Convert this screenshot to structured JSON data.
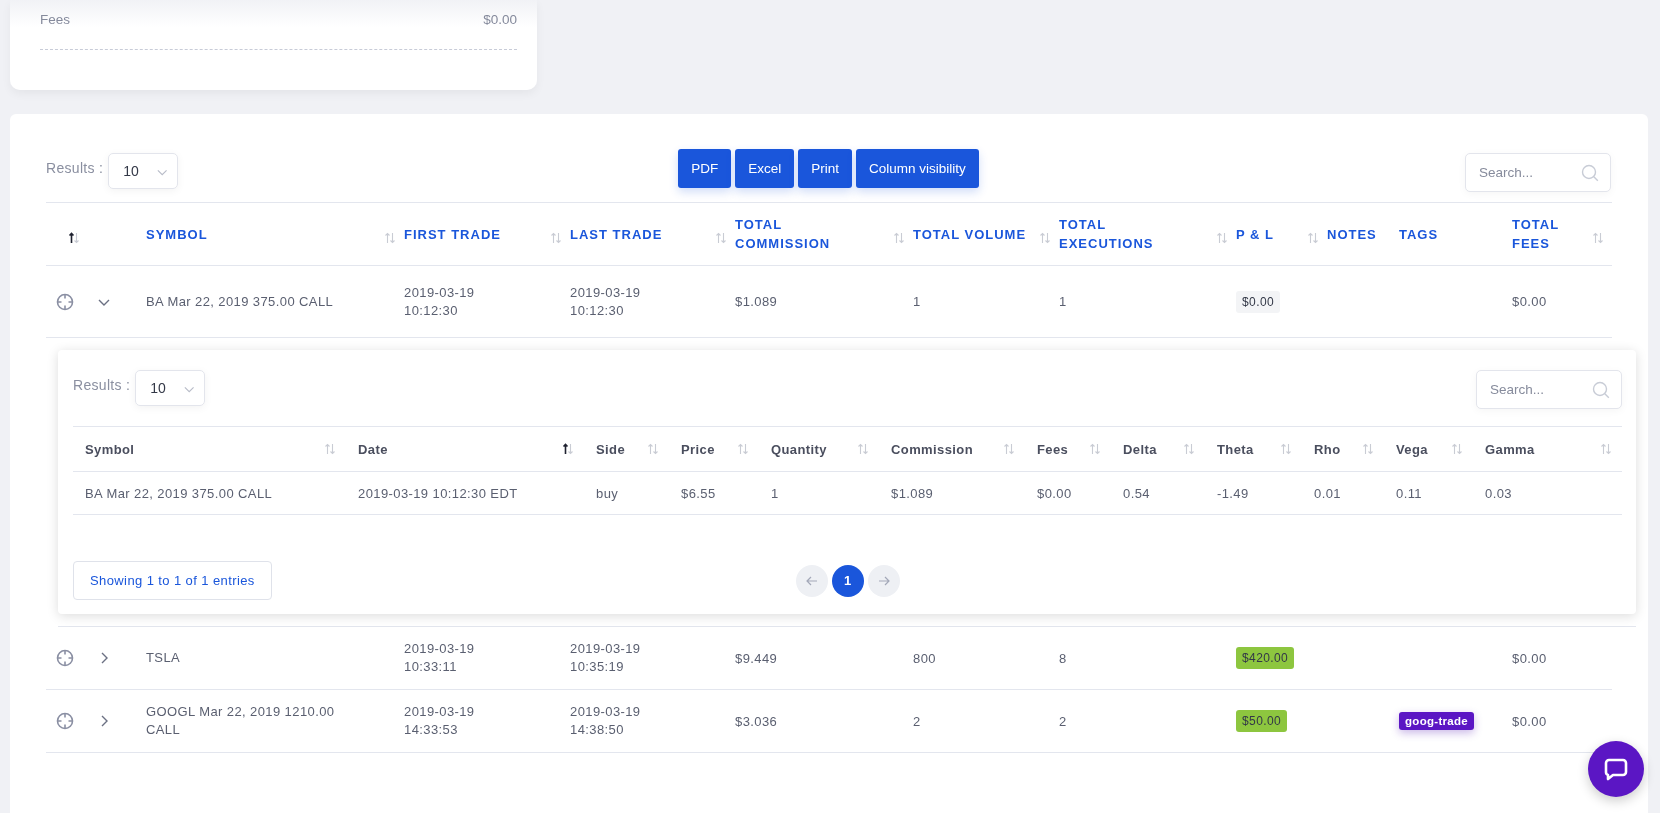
{
  "summary": {
    "rows": [
      {
        "label": "Fees",
        "value": "$0.00"
      }
    ]
  },
  "trades": {
    "results": {
      "label": "Results :",
      "value": "10"
    },
    "buttons": [
      "PDF",
      "Excel",
      "Print",
      "Column visibility"
    ],
    "search": {
      "placeholder": "Search..."
    },
    "columns": [
      {
        "sortable": true,
        "sorted": true
      },
      {
        "label": "SYMBOL",
        "sortable": true,
        "sorted": false
      },
      {
        "label": "FIRST TRADE",
        "sortable": true,
        "sorted": false
      },
      {
        "label": "LAST TRADE",
        "sortable": true,
        "sorted": false
      },
      {
        "label": "TOTAL COMMISSION",
        "sortable": true,
        "sorted": false
      },
      {
        "label": "TOTAL VOLUME",
        "sortable": true,
        "sorted": false
      },
      {
        "label": "TOTAL EXECUTIONS",
        "sortable": true,
        "sorted": false
      },
      {
        "label": "P & L",
        "sortable": true,
        "sorted": false
      },
      {
        "label": "NOTES",
        "sortable": false
      },
      {
        "label": "TAGS",
        "sortable": false
      },
      {
        "label": "TOTAL FEES",
        "sortable": true,
        "sorted": false
      }
    ],
    "rows": [
      {
        "expanded": true,
        "symbol": "BA Mar 22, 2019 375.00 CALL",
        "first_trade": "2019-03-19 10:12:30",
        "last_trade": "2019-03-19 10:12:30",
        "commission": "$1.089",
        "volume": "1",
        "executions": "1",
        "pnl": {
          "text": "$0.00",
          "color": "#f3f4f6"
        },
        "tags": [],
        "fees": "$0.00",
        "detail": {
          "results": {
            "label": "Results :",
            "value": "10"
          },
          "search": {
            "placeholder": "Search..."
          },
          "columns": [
            {
              "label": "Symbol",
              "sorted": false
            },
            {
              "label": "Date",
              "sorted": true
            },
            {
              "label": "Side",
              "sorted": false
            },
            {
              "label": "Price",
              "sorted": false
            },
            {
              "label": "Quantity",
              "sorted": false
            },
            {
              "label": "Commission",
              "sorted": false
            },
            {
              "label": "Fees",
              "sorted": false
            },
            {
              "label": "Delta",
              "sorted": false
            },
            {
              "label": "Theta",
              "sorted": false
            },
            {
              "label": "Rho",
              "sorted": false
            },
            {
              "label": "Vega",
              "sorted": false
            },
            {
              "label": "Gamma",
              "sorted": false
            }
          ],
          "rows": [
            {
              "cells": [
                "BA Mar 22, 2019 375.00 CALL",
                "2019-03-19 10:12:30 EDT",
                "buy",
                "$6.55",
                "1",
                "$1.089",
                "$0.00",
                "0.54",
                "-1.49",
                "0.01",
                "0.11",
                "0.03"
              ]
            }
          ],
          "info": "Showing 1 to 1 of 1 entries",
          "pages": [
            {
              "label": "1",
              "selected": true
            }
          ]
        }
      },
      {
        "expanded": false,
        "symbol": "TSLA",
        "first_trade": "2019-03-19 10:33:11",
        "last_trade": "2019-03-19 10:35:19",
        "commission": "$9.449",
        "volume": "800",
        "executions": "8",
        "pnl": {
          "text": "$420.00",
          "color": "#8dc63f"
        },
        "tags": [],
        "fees": "$0.00"
      },
      {
        "expanded": false,
        "symbol": "GOOGL Mar 22, 2019 1210.00 CALL",
        "first_trade": "2019-03-19 14:33:53",
        "last_trade": "2019-03-19 14:38:50",
        "commission": "$3.036",
        "volume": "2",
        "executions": "2",
        "pnl": {
          "text": "$50.00",
          "color": "#8dc63f"
        },
        "tags": [
          {
            "text": "goog-trade",
            "color": "#5b16c4"
          }
        ],
        "fees": "$0.00"
      }
    ]
  }
}
